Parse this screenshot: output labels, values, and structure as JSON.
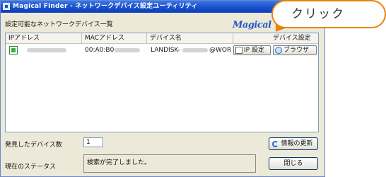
{
  "window": {
    "title": "Magical Finder - ネットワークデバイス設定ユーティリティ",
    "brand": "Magical"
  },
  "device_list": {
    "label": "設定可能なネットワークデバイス一覧",
    "columns": [
      "IPアドレス",
      "MACアドレス",
      "デバイス名",
      "デバイス設定"
    ],
    "rows": [
      {
        "ip": "",
        "mac": "00:A0:B0-",
        "device_name_prefix": "LANDISK-",
        "device_name_suffix": "@WORKGF",
        "ip_setting_button": "IP 設定",
        "browser_button": "ブラウザ"
      }
    ]
  },
  "found_count": {
    "label": "発見したデバイス数",
    "value": "1"
  },
  "status": {
    "label": "現在のステータス",
    "text": "検索が完了しました。"
  },
  "buttons": {
    "refresh": "情報の更新",
    "close": "閉じる"
  },
  "callout": {
    "text": "クリック",
    "color": "#e8830d"
  }
}
